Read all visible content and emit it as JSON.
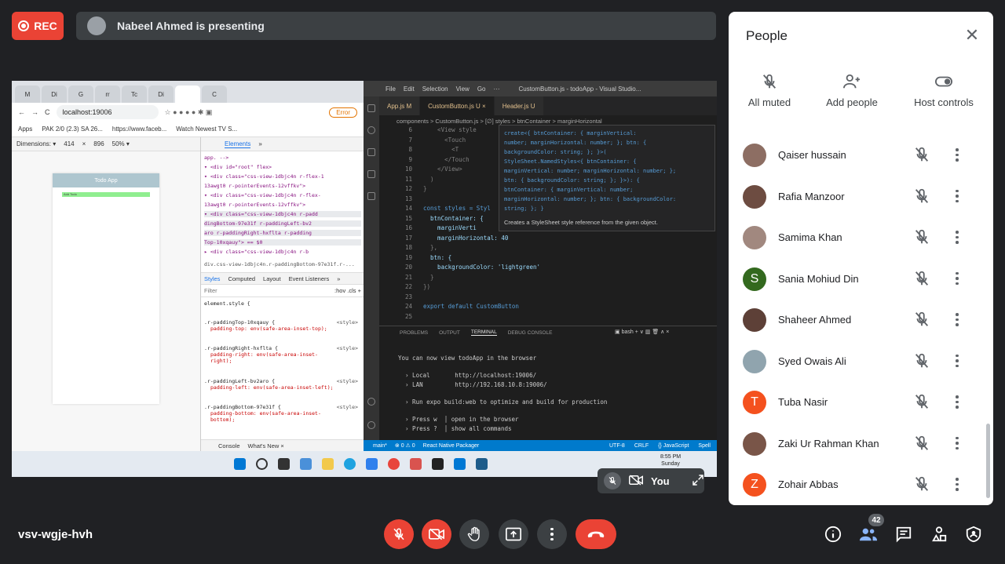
{
  "top": {
    "rec_label": "REC",
    "presenting_text": "Nabeel Ahmed is presenting"
  },
  "screen": {
    "chrome": {
      "tabs": [
        "M",
        "Di",
        "G",
        "rr",
        "Tc",
        "Di",
        "",
        "C"
      ],
      "address": "localhost:19006",
      "error_label": "Error",
      "bookmarks": [
        "Apps",
        "PAK 2/0 (2.3) SA 26...",
        "https://www.faceb...",
        "Watch Newest TV S..."
      ],
      "device_toolbar": {
        "dimensions": "Dimensions: ▾",
        "width": "414",
        "height": "896",
        "zoom": "50% ▾"
      },
      "app_header": "Todo App",
      "app_button": "Add Todo"
    },
    "devtools": {
      "tabs": [
        "Elements",
        "»"
      ],
      "html_lines": [
        "app. -->",
        "▾ <div id=\"root\" flex>",
        "▾ <div class=\"css-view-1dbjc4n r-flex-1",
        "13awgt0 r-pointerEvents-12vffkv\">",
        "▾ <div class=\"css-view-1dbjc4n r-flex-",
        "13awgt0 r-pointerEvents-12vffkv\">",
        "▾ <div class=\"css-view-1dbjc4n r-padd",
        "dingBottom-97e31f r-paddingLeft-bv2",
        "aro r-paddingRight-hxflta r-padding",
        "Top-10xqauy\"> == $0",
        "▸ <div class=\"css-view-1dbjc4n r-b"
      ],
      "breadcrumb": "div.css-view-1dbjc4n.r-paddingBottom-97e31f.r-...",
      "style_tabs": [
        "Styles",
        "Computed",
        "Layout",
        "Event Listeners",
        "»"
      ],
      "filter_placeholder": "Filter",
      "filter_tools": ":hov  .cls  +",
      "rules": [
        {
          "selector": "element.style {",
          "props": [],
          "src": ""
        },
        {
          "selector": ".r-paddingTop-10xqauy {",
          "props": [
            "padding-top: env(safe-area-inset-top);"
          ],
          "src": "<style>"
        },
        {
          "selector": ".r-paddingRight-hxflta {",
          "props": [
            "padding-right: env(safe-area-inset-",
            "right);"
          ],
          "src": "<style>"
        },
        {
          "selector": ".r-paddingLeft-bv2aro {",
          "props": [
            "padding-left: env(safe-area-inset-left);"
          ],
          "src": "<style>"
        },
        {
          "selector": ".r-paddingBottom-97e31f {",
          "props": [
            "padding-bottom: env(safe-area-inset-",
            "bottom);"
          ],
          "src": "<style>"
        }
      ],
      "console_tabs": [
        "Console",
        "What's New ×"
      ]
    },
    "vscode": {
      "menu": [
        "File",
        "Edit",
        "Selection",
        "View",
        "Go",
        "···"
      ],
      "title": "CustomButton.js - todoApp - Visual Studio...",
      "tabs": [
        "App.js  M",
        "CustomButton.js  U  ×",
        "Header.js  U"
      ],
      "breadcrumb": "components > CustomButton.js > [∅] styles > btnContainer > marginHorizontal",
      "lines": [
        {
          "n": "6",
          "t": "    <View style"
        },
        {
          "n": "7",
          "t": "      <Touch"
        },
        {
          "n": "8",
          "t": "        <T"
        },
        {
          "n": "9",
          "t": "      </Touch"
        },
        {
          "n": "10",
          "t": "    </View>"
        },
        {
          "n": "11",
          "t": "  )"
        },
        {
          "n": "12",
          "t": "}"
        },
        {
          "n": "13",
          "t": ""
        },
        {
          "n": "14",
          "t": "const styles = Styl"
        },
        {
          "n": "15",
          "t": "  btnContainer: {"
        },
        {
          "n": "16",
          "t": "    marginVerti"
        },
        {
          "n": "17",
          "t": "    marginHorizontal: 40"
        },
        {
          "n": "18",
          "t": "  },"
        },
        {
          "n": "19",
          "t": "  btn: {"
        },
        {
          "n": "20",
          "t": "    backgroundColor: 'lightgreen'"
        },
        {
          "n": "21",
          "t": "  }"
        },
        {
          "n": "22",
          "t": "})"
        },
        {
          "n": "23",
          "t": ""
        },
        {
          "n": "24",
          "t": "export default CustomButton"
        },
        {
          "n": "25",
          "t": ""
        }
      ],
      "tooltip": {
        "lines": [
          "create<{ btnContainer: { marginVertical:",
          "number; marginHorizontal: number; }; btn: {",
          "backgroundColor: string; }; }>(",
          "StyleSheet.NamedStyles<{ btnContainer: {",
          "marginVertical: number; marginHorizontal: number; };",
          "btn: { backgroundColor: string; }; }>): {",
          "btnContainer: { marginVertical: number;",
          "marginHorizontal: number; }; btn: { backgroundColor:",
          "string; }; }"
        ],
        "description": "Creates a StyleSheet style reference from the given object."
      },
      "panel_tabs": [
        "PROBLEMS",
        "OUTPUT",
        "TERMINAL",
        "DEBUG CONSOLE"
      ],
      "terminal_shell": "bash",
      "terminal": [
        "You can now view todoApp in the browser",
        "",
        "  › Local       http://localhost:19006/",
        "  › LAN         http://192.168.10.8:19006/",
        "",
        "  › Run expo build:web to optimize and build for production",
        "",
        "  › Press w  │ open in the browser",
        "  › Press ?  │ show all commands"
      ],
      "status_left": [
        "main*",
        "⊗ 0 ⚠ 0",
        "React Native Packager"
      ],
      "status_right": [
        "UTF-8",
        "CRLF",
        "{} JavaScript",
        "Spell"
      ]
    },
    "taskbar": {
      "time": "8:55 PM",
      "day": "Sunday"
    }
  },
  "self_tile": {
    "label": "You"
  },
  "people_panel": {
    "title": "People",
    "actions": [
      {
        "label": "All muted",
        "icon": "mic-off-icon"
      },
      {
        "label": "Add people",
        "icon": "add-person-icon"
      },
      {
        "label": "Host controls",
        "icon": "toggle-icon"
      }
    ],
    "participants": [
      {
        "name": "Qaiser hussain",
        "initial": "",
        "color": "#8d6e63"
      },
      {
        "name": "Rafia Manzoor",
        "initial": "",
        "color": "#6d4c41"
      },
      {
        "name": "Samima Khan",
        "initial": "",
        "color": "#a1887f"
      },
      {
        "name": "Sania Mohiud Din",
        "initial": "S",
        "color": "#33691e"
      },
      {
        "name": "Shaheer Ahmed",
        "initial": "",
        "color": "#5d4037"
      },
      {
        "name": "Syed Owais Ali",
        "initial": "",
        "color": "#90a4ae"
      },
      {
        "name": "Tuba Nasir",
        "initial": "T",
        "color": "#f4511e"
      },
      {
        "name": "Zaki Ur Rahman Khan",
        "initial": "",
        "color": "#795548"
      },
      {
        "name": "Zohair Abbas",
        "initial": "Z",
        "color": "#f4511e"
      }
    ]
  },
  "bottom": {
    "meeting_code": "vsv-wgje-hvh",
    "participant_count": "42"
  }
}
